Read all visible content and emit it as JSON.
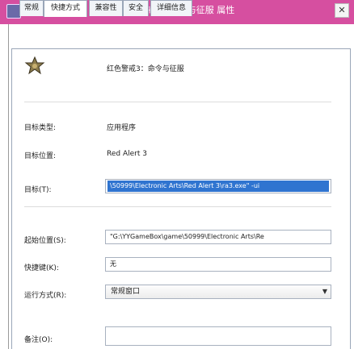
{
  "window": {
    "title": "红色警戒3：命令与征服 属性",
    "close_label": "✕"
  },
  "tabs": [
    {
      "label": "常规"
    },
    {
      "label": "快捷方式"
    },
    {
      "label": "兼容性"
    },
    {
      "label": "安全"
    },
    {
      "label": "详细信息"
    }
  ],
  "shortcut": {
    "name": "红色警戒3：命令与征服",
    "rows": [
      {
        "label": "目标类型:",
        "value": "应用程序"
      },
      {
        "label": "目标位置:",
        "value": "Red Alert 3"
      }
    ],
    "target": {
      "label": "目标(T):",
      "value": "\\50999\\Electronic Arts\\Red Alert 3\\ra3.exe\" -ui"
    },
    "start_in": {
      "label": "起始位置(S):",
      "value": "\"G:\\YYGameBox\\game\\50999\\Electronic Arts\\Re"
    },
    "hotkey": {
      "label": "快捷键(K):",
      "value": "无"
    },
    "run": {
      "label": "运行方式(R):",
      "value": "常规窗口"
    },
    "comment": {
      "label": "备注(O):",
      "value": ""
    }
  }
}
